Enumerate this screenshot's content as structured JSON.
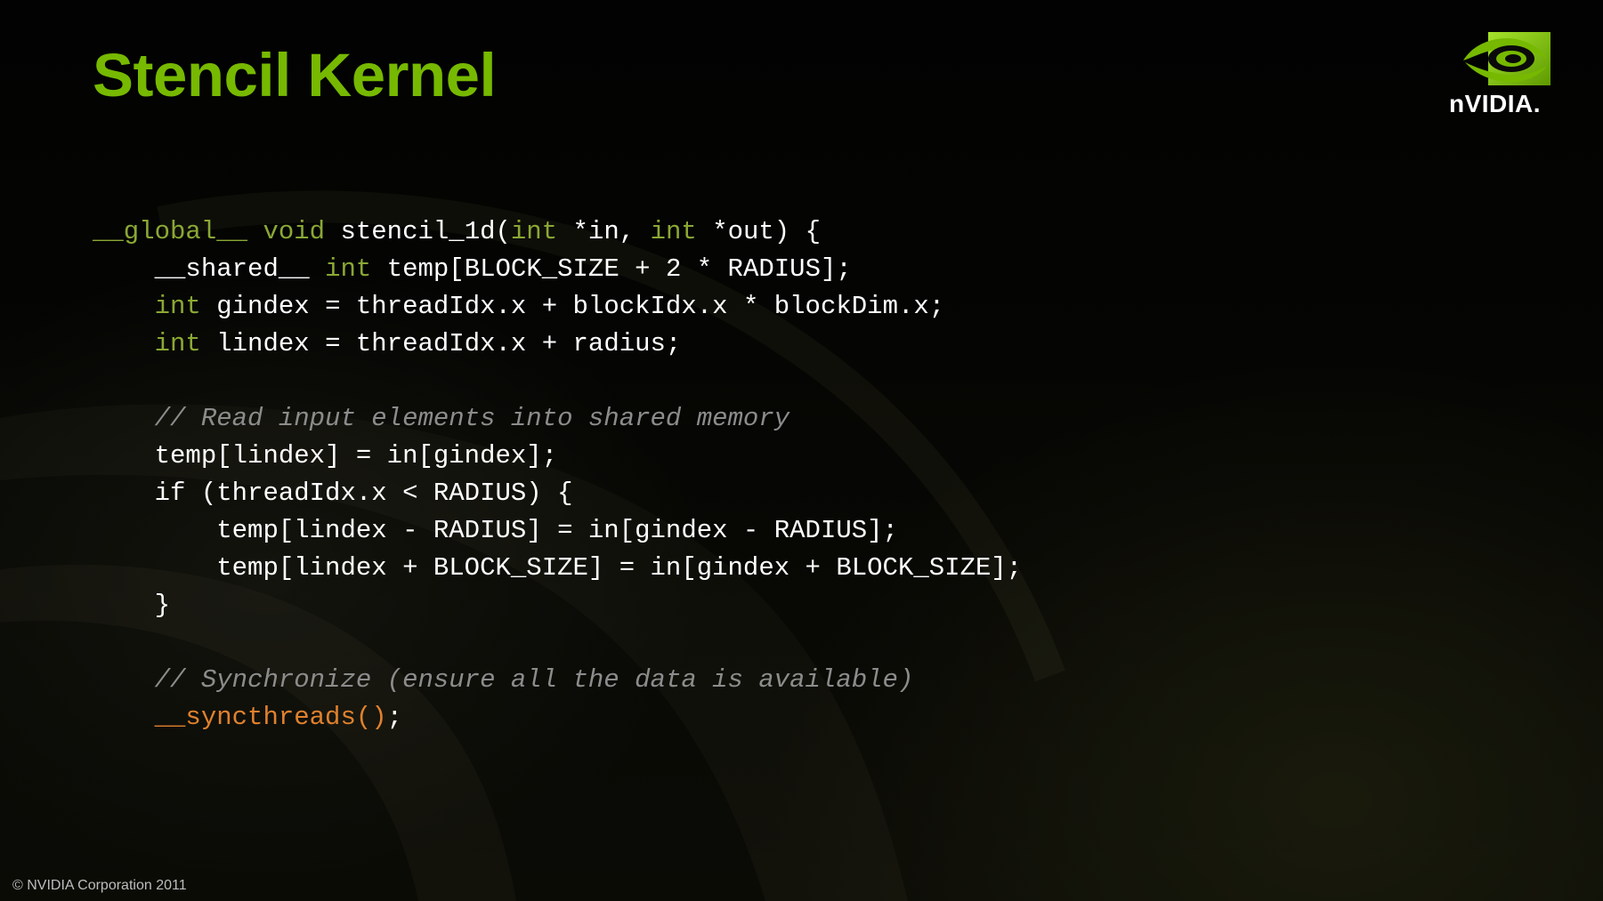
{
  "slide": {
    "title": "Stencil Kernel",
    "footer": "© NVIDIA Corporation 2011"
  },
  "logo": {
    "wordmark": "nVIDIA.",
    "icon": "nvidia-eye-icon",
    "brand_color": "#76b900"
  },
  "colors": {
    "title": "#76b900",
    "keyword": "#8aa834",
    "comment": "#8c8c8c",
    "builtin_call": "#e0812d",
    "code_text": "#ffffff"
  },
  "code": {
    "l1": {
      "kw1": "__global__",
      "kw2": "void",
      "t1": "stencil_1d(",
      "kw3": "int",
      "t2": "*in,",
      "kw4": "int",
      "t3": "*out) {"
    },
    "l2": {
      "t1": "__shared__",
      "kw1": "int",
      "t2": "temp[BLOCK_SIZE + 2 * RADIUS];"
    },
    "l3": {
      "kw1": "int",
      "t1": "gindex = threadIdx.x + blockIdx.x * blockDim.x;"
    },
    "l4": {
      "kw1": "int",
      "t1": "lindex = threadIdx.x + radius;"
    },
    "l6": {
      "comment": "// Read input elements into shared memory"
    },
    "l7": {
      "t1": "temp[lindex] = in[gindex];"
    },
    "l8": {
      "t1": "if (threadIdx.x < RADIUS) {"
    },
    "l9": {
      "t1": "temp[lindex - RADIUS] = in[gindex - RADIUS];"
    },
    "l10": {
      "t1": "temp[lindex + BLOCK_SIZE] = in[gindex + BLOCK_SIZE];"
    },
    "l11": {
      "t1": "}"
    },
    "l13": {
      "comment": "// Synchronize (ensure all the data is available)"
    },
    "l14": {
      "fn": "__syncthreads()",
      "t1": ";"
    }
  }
}
